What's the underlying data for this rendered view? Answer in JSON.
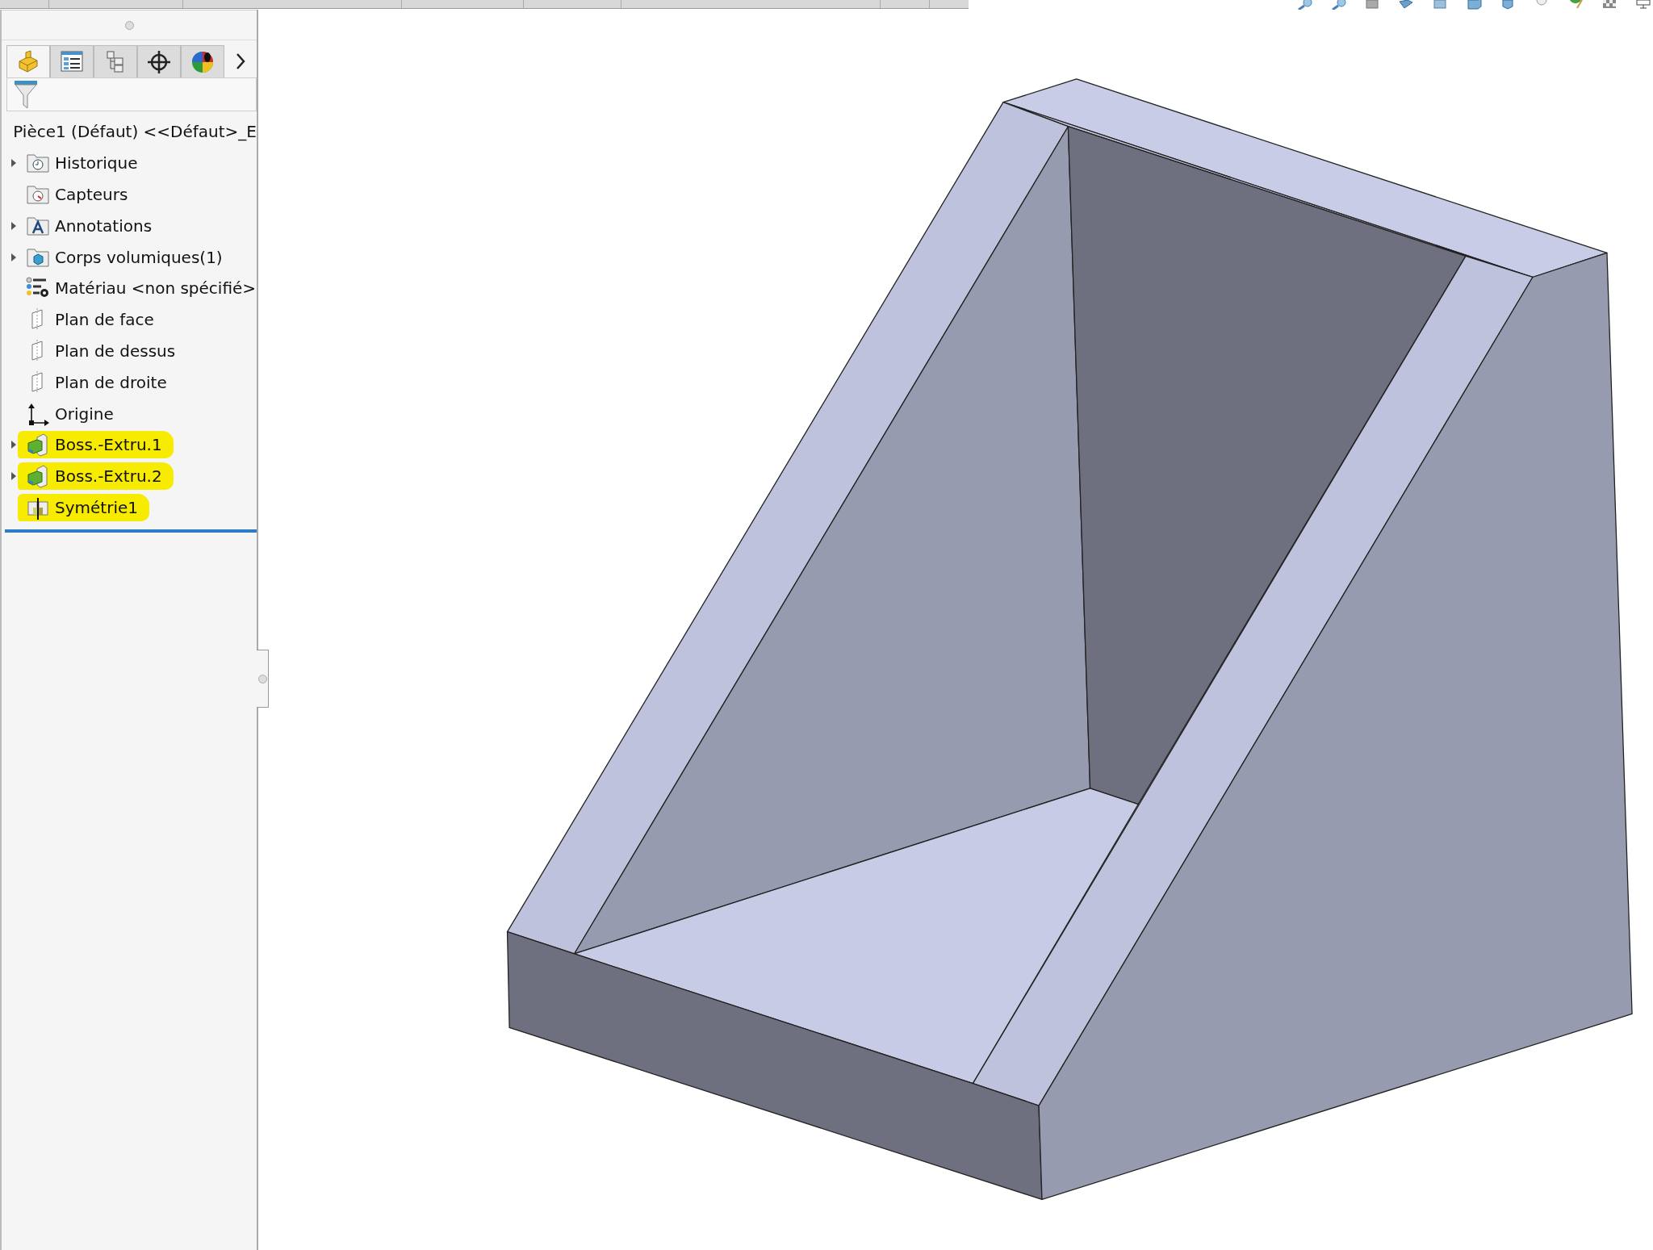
{
  "panel_tabs": [
    {
      "kind": "part",
      "selected": true
    },
    {
      "kind": "properties",
      "selected": false
    },
    {
      "kind": "configurations",
      "selected": false
    },
    {
      "kind": "target",
      "selected": false
    },
    {
      "kind": "appearance",
      "selected": false
    }
  ],
  "feature_tree": {
    "root": {
      "label": "Pièce1 (Défaut) <<Défaut>_E",
      "kind": "part"
    },
    "items": [
      {
        "label": "Historique",
        "kind": "history",
        "expandable": true,
        "highlighted": false
      },
      {
        "label": "Capteurs",
        "kind": "sensors",
        "expandable": false,
        "highlighted": false
      },
      {
        "label": "Annotations",
        "kind": "annotations",
        "expandable": true,
        "highlighted": false
      },
      {
        "label": "Corps volumiques(1)",
        "kind": "bodies",
        "expandable": true,
        "highlighted": false
      },
      {
        "label": "Matériau <non spécifié>",
        "kind": "material",
        "expandable": false,
        "highlighted": false
      },
      {
        "label": "Plan de face",
        "kind": "plane",
        "expandable": false,
        "highlighted": false
      },
      {
        "label": "Plan de dessus",
        "kind": "plane",
        "expandable": false,
        "highlighted": false
      },
      {
        "label": "Plan de droite",
        "kind": "plane",
        "expandable": false,
        "highlighted": false
      },
      {
        "label": "Origine",
        "kind": "origin",
        "expandable": false,
        "highlighted": false
      },
      {
        "label": "Boss.-Extru.1",
        "kind": "extrude",
        "expandable": true,
        "highlighted": true
      },
      {
        "label": "Boss.-Extru.2",
        "kind": "extrude",
        "expandable": true,
        "highlighted": true
      },
      {
        "label": "Symétrie1",
        "kind": "mirror",
        "expandable": false,
        "highlighted": true
      }
    ]
  }
}
